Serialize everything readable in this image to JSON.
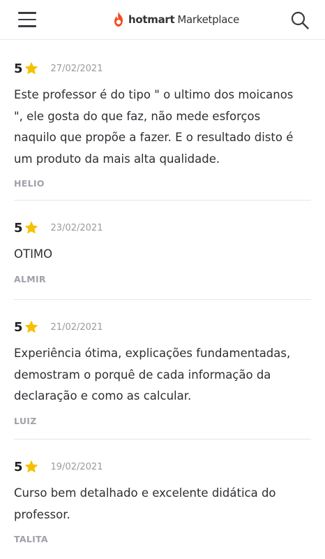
{
  "header": {
    "logo_brand": "hotmart",
    "logo_suffix": "Marketplace",
    "brand_color": "#ef4d23"
  },
  "icons": {
    "menu": "hamburger-menu-icon",
    "search": "search-icon",
    "star": "star-icon",
    "star_color": "#f6c000"
  },
  "reviews": [
    {
      "rating": "5",
      "date": "27/02/2021",
      "comment_lines": [
        "Este professor é do tipo \" o ultimo dos moicanos",
        "\", ele gosta do que faz, não mede esforços",
        "naquilo que propõe a fazer. E o resultado disto é",
        "um produto da mais alta qualidade."
      ],
      "author": "HELIO"
    },
    {
      "rating": "5",
      "date": "23/02/2021",
      "comment_lines": [
        "OTIMO"
      ],
      "author": "ALMIR"
    },
    {
      "rating": "5",
      "date": "21/02/2021",
      "comment_lines": [
        "Experiência ótima, explicações fundamentadas,",
        "demostram o porquê de cada informação da",
        "declaração e como as calcular."
      ],
      "author": "LUIZ"
    },
    {
      "rating": "5",
      "date": "19/02/2021",
      "comment_lines": [
        "Curso bem detalhado e excelente didática do",
        "professor."
      ],
      "author": "TALITA"
    }
  ]
}
